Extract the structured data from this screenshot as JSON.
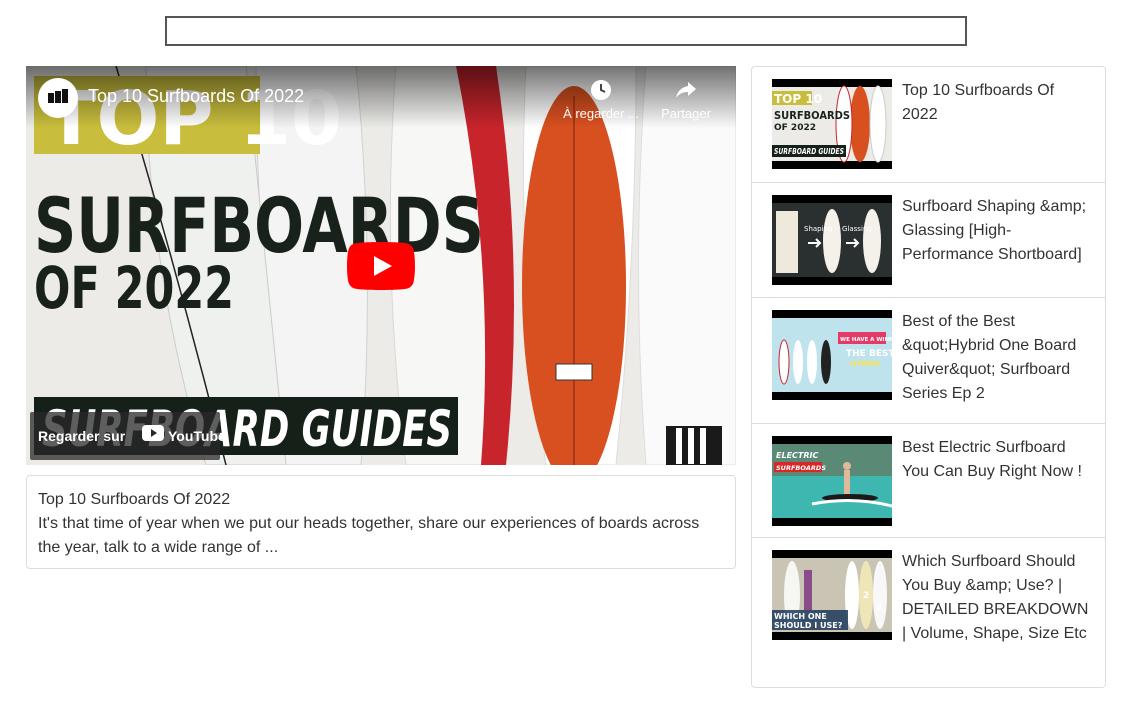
{
  "search": {
    "placeholder": ""
  },
  "player": {
    "title": "Top 10 Surfboards Of 2022",
    "watch_later_label": "À regarder ...",
    "share_label": "Partager",
    "watch_on_label": "Regarder sur",
    "youtube_label": "YouTube",
    "thumbnail_text": {
      "line1": "TOP 10",
      "line2": "SURFBOARDS",
      "line3": "OF 2022",
      "banner": "SURFBOARD GUIDES"
    },
    "colors": {
      "play_red": "#ff0000",
      "banner_yellow": "#c8bd3c",
      "banner_dark": "#152018"
    }
  },
  "description": {
    "title": "Top 10 Surfboards Of 2022",
    "text": "It's that time of year when we put our heads together, share our experiences of boards across the year, talk to a wide range of ..."
  },
  "playlist": {
    "items": [
      {
        "title": "Top 10 Surfboards Of 2022",
        "thumb_text_a": "TOP 10",
        "thumb_text_b": "SURFBOARDS",
        "thumb_text_c": "OF 2022",
        "thumb_text_d": "SURFBOARD GUIDES"
      },
      {
        "title": "Surfboard Shaping &amp; Glassing [High-Performance Shortboard]",
        "thumb_text_a": "Shaping",
        "thumb_text_b": "Glassing"
      },
      {
        "title": "Best of the Best &quot;Hybrid One Board Quiver&quot; Surfboard Series Ep 2",
        "thumb_text_a": "WE HAVE A WINNER!",
        "thumb_text_b": "THE BEST",
        "thumb_text_c": "HYBRID"
      },
      {
        "title": "Best Electric Surfboard You Can Buy Right Now !",
        "thumb_text_a": "ELECTRIC",
        "thumb_text_b": "SURFBOARDS"
      },
      {
        "title": "Which Surfboard Should You Buy &amp; Use? | DETAILED BREAKDOWN | Volume, Shape, Size Etc",
        "thumb_text_a": "WHICH ONE",
        "thumb_text_b": "SHOULD I USE?"
      }
    ]
  }
}
